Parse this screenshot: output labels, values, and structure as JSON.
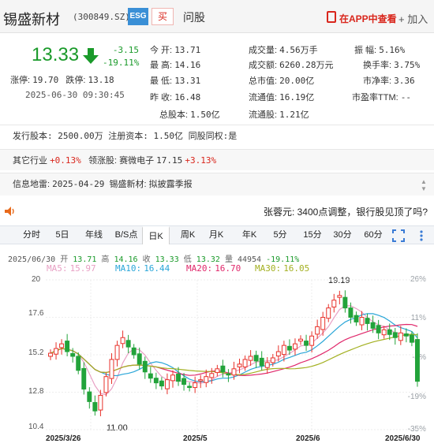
{
  "header": {
    "name": "锡盛新材",
    "code": "(300849.SZ)",
    "esg": "ESG",
    "buy": "买",
    "ask": "问股",
    "app_link": "在APP中查看",
    "add": "+ 加入"
  },
  "quote": {
    "price": "13.33",
    "change": "-3.15",
    "change_pct": "-19.11%",
    "limit_up_label": "涨停:",
    "limit_up": "19.70",
    "limit_down_label": "跌停:",
    "limit_down": "13.18",
    "time": "2025-06-30 09:30:45"
  },
  "stats": [
    {
      "label": "今    开:",
      "value": "13.71"
    },
    {
      "label": "最    高:",
      "value": "14.16"
    },
    {
      "label": "最    低:",
      "value": "13.31"
    },
    {
      "label": "昨    收:",
      "value": "16.48"
    },
    {
      "label": "总股本:",
      "value": "1.50亿"
    },
    {
      "label": "成交量:",
      "value": "4.56万手"
    },
    {
      "label": "成交额:",
      "value": "6260.28万元"
    },
    {
      "label": "总市值:",
      "value": "20.00亿"
    },
    {
      "label": "流通值:",
      "value": "16.19亿"
    },
    {
      "label": "流通股:",
      "value": "1.21亿"
    },
    {
      "label": "振    幅:",
      "value": "5.16%"
    },
    {
      "label": "换手率:",
      "value": "3.75%"
    },
    {
      "label": "市净率:",
      "value": "3.36"
    },
    {
      "label": "市盈率TTM:",
      "value": "--"
    }
  ],
  "info": {
    "issue": "发行股本: 2500.00万  注册资本: 1.50亿  同股同权:是",
    "industry_label": "其它行业",
    "industry_chg": "+0.13%",
    "leader_label": "领涨股:",
    "leader_name": "赛微电子",
    "leader_price": "17.15",
    "leader_chg": "+3.13%",
    "notice_label": "信息地雷:",
    "notice_date": "2025-04-29",
    "notice_text": "锡盛新材: 拟披露季报"
  },
  "news": "张蓉元: 3400点调整，银行股见顶了吗?",
  "tabs": [
    "分时",
    "5日",
    "年线",
    "B/S点",
    "日K",
    "周K",
    "月K",
    "年K",
    "5分",
    "15分",
    "30分",
    "60分"
  ],
  "active_tab": "日K",
  "ohlc": {
    "date": "2025/06/30",
    "open_label": "开",
    "open": "13.71",
    "high_label": "高",
    "high": "14.16",
    "close_label": "收",
    "close": "13.33",
    "low_label": "低",
    "low": "13.32",
    "vol_label": "量",
    "vol": "44954",
    "pct": "-19.11%"
  },
  "ma": [
    {
      "label": "MA5:",
      "value": "15.97",
      "color": "#e8a0c4"
    },
    {
      "label": "MA10:",
      "value": "16.44",
      "color": "#2aa6d8"
    },
    {
      "label": "MA20:",
      "value": "16.70",
      "color": "#e0286b"
    },
    {
      "label": "MA30:",
      "value": "16.05",
      "color": "#a3b021"
    }
  ],
  "chart_data": {
    "type": "candlestick",
    "y_ticks": [
      "20",
      "17.6",
      "15.2",
      "12.8",
      "10.4"
    ],
    "pct_ticks": [
      "26%",
      "11%",
      "-4%",
      "-19%",
      "-35%"
    ],
    "x_ticks": [
      "2025/3/26",
      "2025/5",
      "2025/6",
      "2025/6/30"
    ],
    "ylim": [
      10.4,
      20
    ],
    "high_label": "19.19",
    "low_label": "11.00",
    "colors": {
      "up": "#e8312a",
      "down": "#22a33a"
    }
  }
}
